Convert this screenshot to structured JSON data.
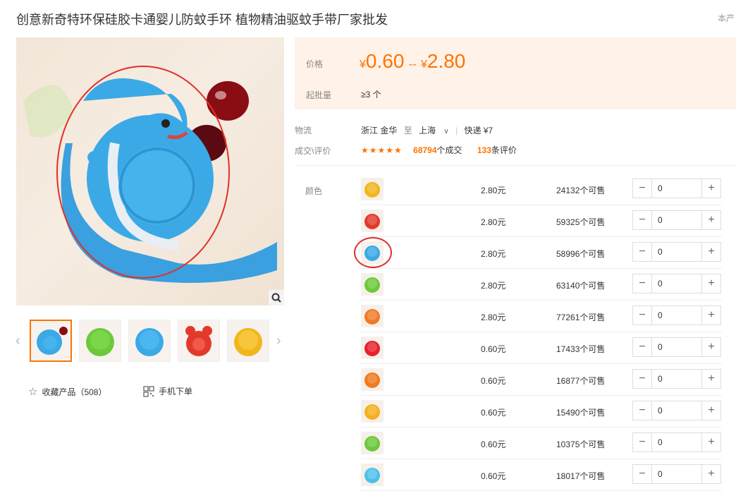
{
  "title": "创意新奇特环保硅胶卡通婴儿防蚊手环 植物精油驱蚊手带厂家批发",
  "title_right": "本产",
  "price": {
    "label": "价格",
    "currency": "¥",
    "min": "0.60",
    "separator": "--",
    "max": "2.80",
    "batch_label": "起批量",
    "batch_value": "≥3 个"
  },
  "logistics": {
    "label": "物流",
    "from": "浙江 金华",
    "to_word": "至",
    "to": "上海",
    "express": "快递 ¥7"
  },
  "deal": {
    "label": "成交\\评价",
    "stars": "★★★★★",
    "deals_num": "68794",
    "deals_text": "个成交",
    "reviews_num": "133",
    "reviews_text": "条评价"
  },
  "actions": {
    "favorite": "收藏产品（508）",
    "mobile_order": "手机下单"
  },
  "sku_label": "颜色",
  "sku_rows": [
    {
      "price": "2.80元",
      "stock": "24132个可售",
      "qty": "0",
      "color": "#f2b61c"
    },
    {
      "price": "2.80元",
      "stock": "59325个可售",
      "qty": "0",
      "color": "#e23a2a"
    },
    {
      "price": "2.80元",
      "stock": "58996个可售",
      "qty": "0",
      "color": "#3aa9e6"
    },
    {
      "price": "2.80元",
      "stock": "63140个可售",
      "qty": "0",
      "color": "#6cc93a"
    },
    {
      "price": "2.80元",
      "stock": "77261个可售",
      "qty": "0",
      "color": "#f07a26"
    },
    {
      "price": "0.60元",
      "stock": "17433个可售",
      "qty": "0",
      "color": "#e8202a"
    },
    {
      "price": "0.60元",
      "stock": "16877个可售",
      "qty": "0",
      "color": "#f07a1c"
    },
    {
      "price": "0.60元",
      "stock": "15490个可售",
      "qty": "0",
      "color": "#f5b01c"
    },
    {
      "price": "0.60元",
      "stock": "10375个可售",
      "qty": "0",
      "color": "#6cc93a"
    },
    {
      "price": "0.60元",
      "stock": "18017个可售",
      "qty": "0",
      "color": "#4cc0ec"
    }
  ],
  "colors": {
    "accent": "#ff7300",
    "price_bg": "#fff2e8",
    "highlight": "#e0302a"
  }
}
